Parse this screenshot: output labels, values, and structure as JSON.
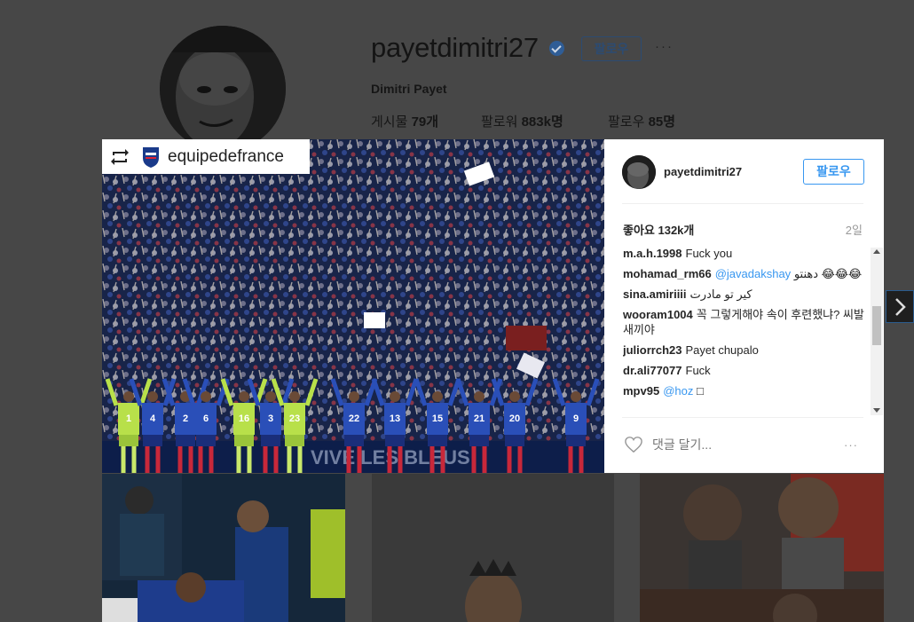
{
  "profile": {
    "username": "payetdimitri27",
    "follow_label": "팔로우",
    "more_label": "···",
    "full_name": "Dimitri Payet",
    "stats": [
      {
        "label": "게시물",
        "value": "79개"
      },
      {
        "label": "팔로워",
        "value": "883k명"
      },
      {
        "label": "팔로우",
        "value": "85명"
      }
    ]
  },
  "post": {
    "repost_account": "equipedefrance",
    "author": "payetdimitri27",
    "follow_label": "팔로우",
    "likes": "좋아요 132k개",
    "time": "2일",
    "comments": [
      {
        "user": "m.a.h.1998",
        "text": "Fuck you",
        "mention": ""
      },
      {
        "user": "mohamad_rm66",
        "mention": "@javadakshay",
        "text": "دهنتو 😂😂😂"
      },
      {
        "user": "sina.amiriiii",
        "text": "کیر تو مادرت",
        "mention": ""
      },
      {
        "user": "wooram1004",
        "text": "꼭 그렇게해야 속이 후련했냐? 씨발새끼야",
        "mention": ""
      },
      {
        "user": "juliorrch23",
        "text": "Payet chupalo",
        "mention": ""
      },
      {
        "user": "dr.ali77077",
        "text": "Fuck",
        "mention": ""
      },
      {
        "user": "mpv95",
        "mention": "@hoz",
        "text": "□"
      }
    ],
    "comment_placeholder": "댓글 달기...",
    "more_label": "···",
    "jersey_numbers": [
      "1",
      "4",
      "2",
      "6",
      "16",
      "3",
      "23",
      "22",
      "13",
      "15",
      "21",
      "20",
      "9"
    ],
    "banner_text": "VIVE LES BLEUS"
  },
  "colors": {
    "accent": "#3897f0",
    "dim_overlay": "#474747",
    "jersey_blue": "#2a4fb8",
    "gk_green": "#b8e04a"
  }
}
